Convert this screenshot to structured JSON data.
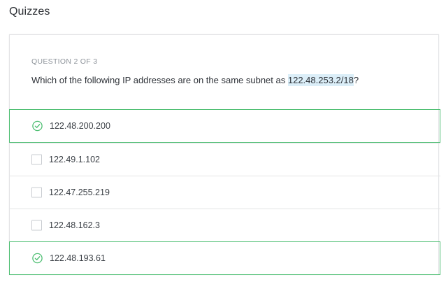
{
  "page": {
    "title": "Quizzes"
  },
  "question": {
    "counter": "QUESTION 2 OF 3",
    "text_before": "Which of the following IP addresses are on the same subnet as ",
    "text_highlight": "122.48.253.2/18",
    "text_after": "?"
  },
  "options": [
    {
      "label": "122.48.200.200",
      "state": "correct",
      "icon": "check-circle-icon"
    },
    {
      "label": "122.49.1.102",
      "state": "unselected",
      "icon": "checkbox-icon"
    },
    {
      "label": "122.47.255.219",
      "state": "unselected",
      "icon": "checkbox-icon"
    },
    {
      "label": "122.48.162.3",
      "state": "unselected",
      "icon": "checkbox-icon"
    },
    {
      "label": "122.48.193.61",
      "state": "correct",
      "icon": "check-circle-icon"
    }
  ],
  "colors": {
    "correct_border": "#4fbf73",
    "highlight_bg": "#dbeef8",
    "divider": "#e3e4e6"
  }
}
